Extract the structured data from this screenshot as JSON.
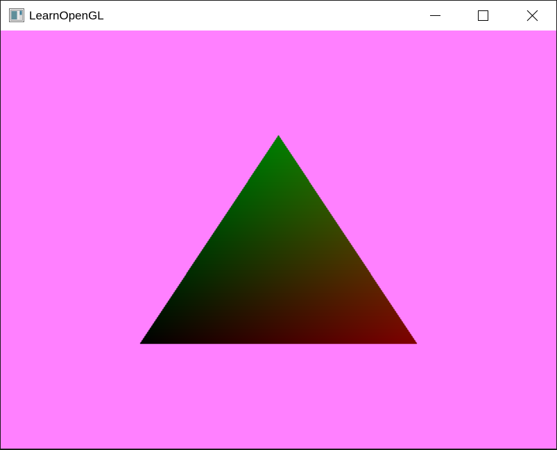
{
  "window": {
    "title": "LearnOpenGL",
    "icon": "app-window-icon"
  },
  "caption_buttons": {
    "minimize_icon": "minimize-icon",
    "maximize_icon": "maximize-icon",
    "close_icon": "close-icon"
  },
  "render": {
    "clear_color": "#ff80ff",
    "triangle": {
      "vertex_colors": {
        "top": "#008000",
        "bottom_left": "#000000",
        "bottom_right": "#800000"
      }
    }
  }
}
